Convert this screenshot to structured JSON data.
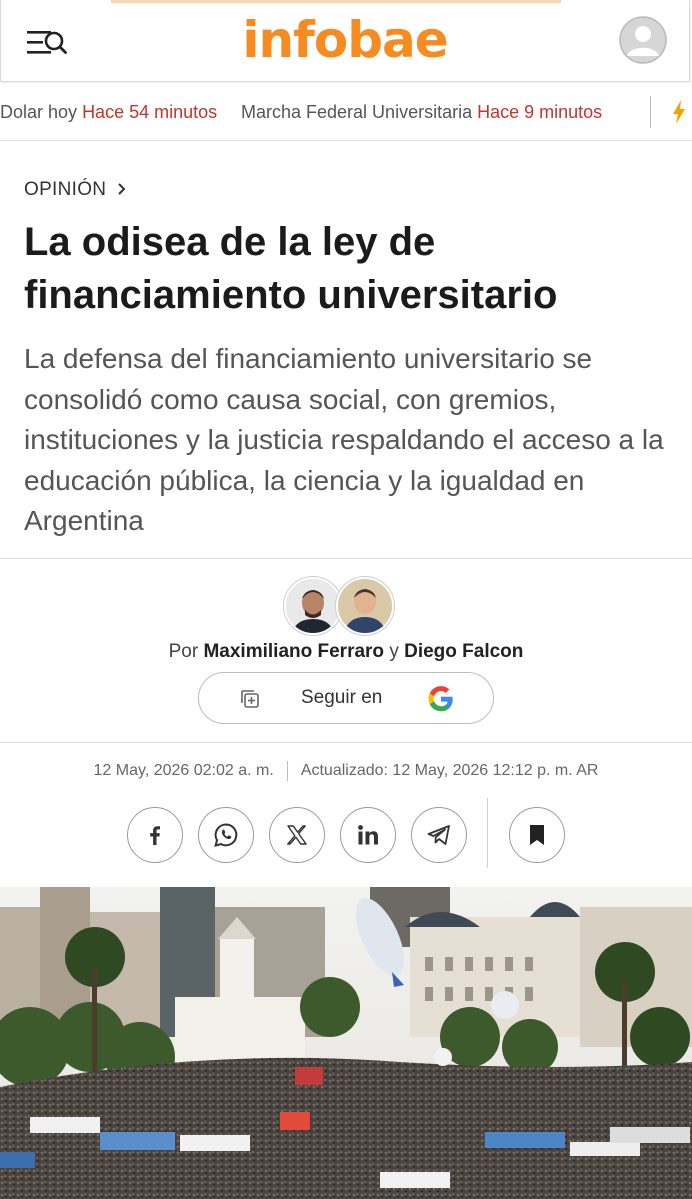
{
  "header": {
    "logo_text": "infobae",
    "brand_color": "#f68b1f",
    "menu_icon": "menu-search-icon",
    "user_icon": "user-avatar-icon"
  },
  "trending": {
    "items": [
      {
        "label": "Dolar hoy",
        "time": "Hace 54 minutos"
      },
      {
        "label": "Marcha Federal Universitaria",
        "time": "Hace 9 minutos"
      }
    ],
    "time_color": "#c8332a",
    "extra_icon": "lightning-icon"
  },
  "article": {
    "section": "OPINIÓN",
    "title": "La odisea de la ley de financiamiento universitario",
    "subtitle": "La defensa del financiamiento universitario se consolidó como causa social, con gremios, instituciones y la justicia respaldando el acceso a la educación pública, la ciencia y la igualdad en Argentina",
    "byline": {
      "prefix": "Por",
      "author1": "Maximiliano Ferraro",
      "joiner": "y",
      "author2": "Diego Falcon"
    },
    "follow": {
      "label": "Seguir en",
      "icon": "google-icon"
    },
    "published": "12 May, 2026 02:02 a. m.",
    "updated": "Actualizado: 12 May, 2026 12:12 p. m. AR"
  },
  "share": {
    "buttons": [
      "facebook-icon",
      "whatsapp-icon",
      "x-icon",
      "linkedin-icon",
      "telegram-icon"
    ],
    "save_icon": "bookmark-icon"
  }
}
